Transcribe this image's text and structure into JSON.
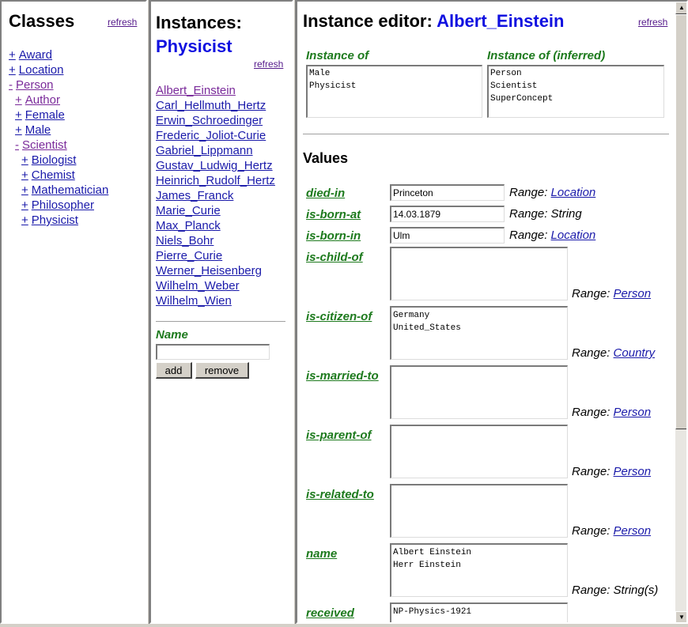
{
  "classes": {
    "title": "Classes",
    "refresh": "refresh",
    "tree": [
      {
        "toggle": "+",
        "label": "Award",
        "level": 0,
        "visited": false
      },
      {
        "toggle": "+",
        "label": "Location",
        "level": 0,
        "visited": false
      },
      {
        "toggle": "-",
        "label": "Person",
        "level": 0,
        "visited": true
      },
      {
        "toggle": "+",
        "label": "Author",
        "level": 1,
        "visited": true
      },
      {
        "toggle": "+",
        "label": "Female",
        "level": 1,
        "visited": false
      },
      {
        "toggle": "+",
        "label": "Male",
        "level": 1,
        "visited": false
      },
      {
        "toggle": "-",
        "label": "Scientist",
        "level": 1,
        "visited": true
      },
      {
        "toggle": "+",
        "label": "Biologist",
        "level": 2,
        "visited": false
      },
      {
        "toggle": "+",
        "label": "Chemist",
        "level": 2,
        "visited": false
      },
      {
        "toggle": "+",
        "label": "Mathematician",
        "level": 2,
        "visited": false
      },
      {
        "toggle": "+",
        "label": "Philosopher",
        "level": 2,
        "visited": false
      },
      {
        "toggle": "+",
        "label": "Physicist",
        "level": 2,
        "visited": false
      }
    ]
  },
  "instances": {
    "title_prefix": "Instances:",
    "class_name": "Physicist",
    "refresh": "refresh",
    "items": [
      "Albert_Einstein",
      "Carl_Hellmuth_Hertz",
      "Erwin_Schroedinger",
      "Frederic_Joliot-Curie",
      "Gabriel_Lippmann",
      "Gustav_Ludwig_Hertz",
      "Heinrich_Rudolf_Hertz",
      "James_Franck",
      "Marie_Curie",
      "Max_Planck",
      "Niels_Bohr",
      "Pierre_Curie",
      "Werner_Heisenberg",
      "Wilhelm_Weber",
      "Wilhelm_Wien"
    ],
    "name_label": "Name",
    "name_value": "",
    "add_label": "add",
    "remove_label": "remove"
  },
  "editor": {
    "title_prefix": "Instance editor:",
    "instance_name": "Albert_Einstein",
    "refresh": "refresh",
    "instance_of_label": "Instance of",
    "instance_of": [
      "Male",
      "Physicist"
    ],
    "instance_of_inferred_label": "Instance of (inferred)",
    "instance_of_inferred": [
      "Person",
      "Scientist",
      "SuperConcept"
    ],
    "values_title": "Values",
    "range_prefix": "Range:",
    "props": [
      {
        "name": "died-in",
        "kind": "input",
        "value": "Princeton",
        "range_link": "Location",
        "range_text": ""
      },
      {
        "name": "is-born-at",
        "kind": "input",
        "value": "14.03.1879",
        "range_link": "",
        "range_text": "String"
      },
      {
        "name": "is-born-in",
        "kind": "input",
        "value": "Ulm",
        "range_link": "Location",
        "range_text": ""
      },
      {
        "name": "is-child-of",
        "kind": "area",
        "value": "",
        "range_link": "Person",
        "range_text": ""
      },
      {
        "name": "is-citizen-of",
        "kind": "area",
        "value": "Germany\nUnited_States",
        "range_link": "Country",
        "range_text": ""
      },
      {
        "name": "is-married-to",
        "kind": "area",
        "value": "",
        "range_link": "Person",
        "range_text": ""
      },
      {
        "name": "is-parent-of",
        "kind": "area",
        "value": "",
        "range_link": "Person",
        "range_text": ""
      },
      {
        "name": "is-related-to",
        "kind": "area",
        "value": "",
        "range_link": "Person",
        "range_text": ""
      },
      {
        "name": "name",
        "kind": "area",
        "value": "Albert Einstein\nHerr Einstein",
        "range_link": "",
        "range_text": "String(s)"
      },
      {
        "name": "received",
        "kind": "area",
        "value": "NP-Physics-1921",
        "range_link": "",
        "range_text": ""
      }
    ]
  },
  "scrollbar": {
    "up_glyph": "▲",
    "down_glyph": "▼"
  }
}
